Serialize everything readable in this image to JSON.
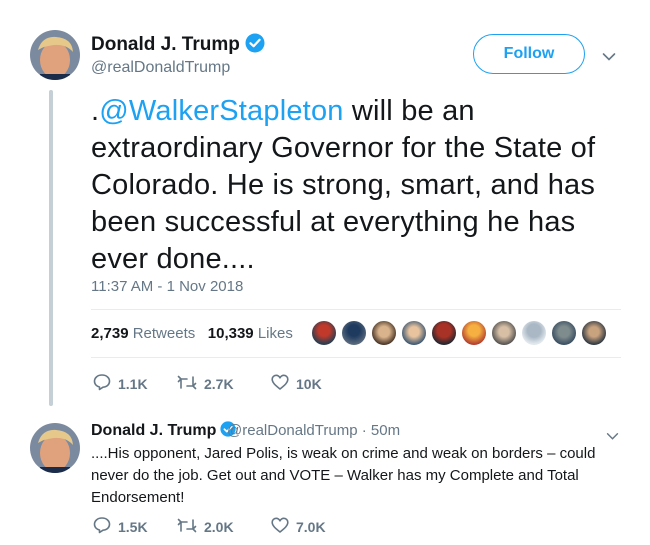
{
  "tweet": {
    "author_name": "Donald J. Trump",
    "author_handle": "@realDonaldTrump",
    "follow_label": "Follow",
    "text_prefix": ".",
    "mention": "@WalkerStapleton",
    "text_body": " will be an extraordinary Governor for the State of Colorado. He is strong, smart, and has been successful at everything he has ever done....",
    "timestamp": "11:37 AM - 1 Nov 2018",
    "retweets_count": "2,739",
    "retweets_label": "Retweets",
    "likes_count": "10,339",
    "likes_label": "Likes",
    "actions": {
      "replies": "1.1K",
      "retweets": "2.7K",
      "likes": "10K"
    }
  },
  "reply": {
    "author_name": "Donald J. Trump",
    "author_handle_time": "@realDonaldTrump · 50m",
    "text": "....His opponent, Jared Polis, is weak on crime and weak on borders – could never do the job. Get out and VOTE – Walker has my Complete and Total Endorsement!",
    "actions": {
      "replies": "1.5K",
      "retweets": "2.0K",
      "likes": "7.0K"
    }
  },
  "colors": {
    "accent": "#1da1f2",
    "secondary_text": "#657786",
    "primary_text": "#14171a"
  },
  "icons": [
    "verified-badge-icon",
    "chevron-down-icon",
    "reply-icon",
    "retweet-icon",
    "like-icon"
  ]
}
